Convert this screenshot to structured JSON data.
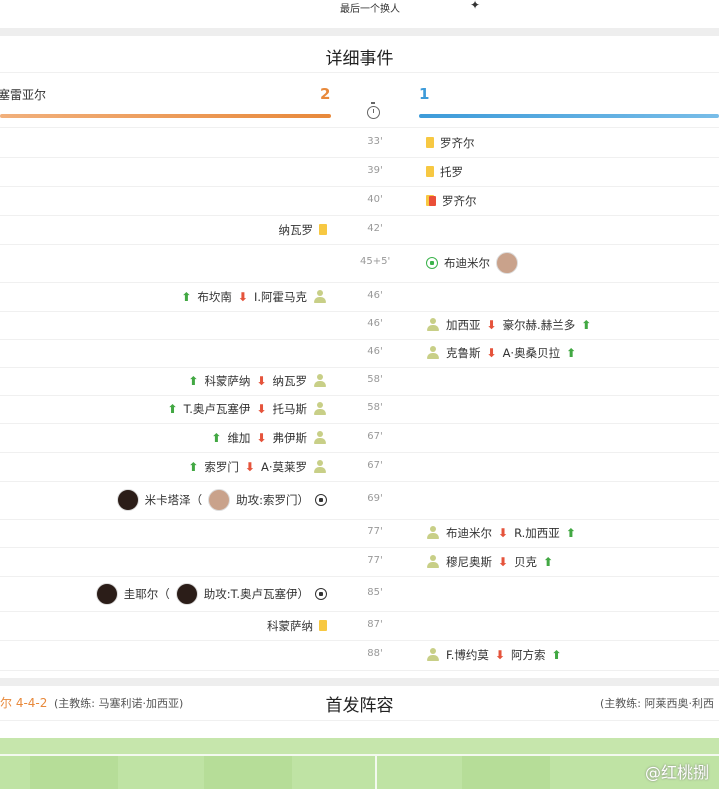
{
  "top": {
    "text": "最后一个换人",
    "icon": "star-icon"
  },
  "events": {
    "title": "详细事件",
    "home_name": "塞雷亚尔",
    "home_score": "2",
    "away_score": "1",
    "rows": [
      {
        "min": "33'",
        "left": [],
        "right": [
          {
            "t": "icon",
            "n": "yellow-card-icon"
          },
          {
            "t": "text",
            "v": "罗齐尔"
          }
        ]
      },
      {
        "min": "39'",
        "left": [],
        "right": [
          {
            "t": "icon",
            "n": "yellow-card-icon"
          },
          {
            "t": "text",
            "v": "托罗"
          }
        ]
      },
      {
        "min": "40'",
        "left": [],
        "right": [
          {
            "t": "icon",
            "n": "red-card-icon"
          },
          {
            "t": "text",
            "v": "罗齐尔"
          }
        ]
      },
      {
        "min": "42'",
        "left": [
          {
            "t": "text",
            "v": "纳瓦罗"
          },
          {
            "t": "icon",
            "n": "yellow-card-icon"
          }
        ],
        "right": []
      },
      {
        "min": "45+5'",
        "left": [],
        "right": [
          {
            "t": "icon",
            "n": "goal-ball-icon"
          },
          {
            "t": "text",
            "v": "布迪米尔"
          },
          {
            "t": "icon",
            "n": "player-avatar-light"
          }
        ]
      },
      {
        "min": "46'",
        "left": [
          {
            "t": "icon",
            "n": "sub-in-icon"
          },
          {
            "t": "text",
            "v": "布坎南"
          },
          {
            "t": "icon",
            "n": "sub-out-icon"
          },
          {
            "t": "text",
            "v": "I.阿霍马克"
          },
          {
            "t": "icon",
            "n": "substitution-person-icon"
          }
        ],
        "right": []
      },
      {
        "min": "46'",
        "left": [],
        "right": [
          {
            "t": "icon",
            "n": "substitution-person-icon"
          },
          {
            "t": "text",
            "v": "加西亚"
          },
          {
            "t": "icon",
            "n": "sub-out-icon"
          },
          {
            "t": "text",
            "v": "豪尔赫.赫兰多"
          },
          {
            "t": "icon",
            "n": "sub-in-icon"
          }
        ]
      },
      {
        "min": "46'",
        "left": [],
        "right": [
          {
            "t": "icon",
            "n": "substitution-person-icon"
          },
          {
            "t": "text",
            "v": "克鲁斯"
          },
          {
            "t": "icon",
            "n": "sub-out-icon"
          },
          {
            "t": "text",
            "v": "A·奥桑贝拉"
          },
          {
            "t": "icon",
            "n": "sub-in-icon"
          }
        ]
      },
      {
        "min": "58'",
        "left": [
          {
            "t": "icon",
            "n": "sub-in-icon"
          },
          {
            "t": "text",
            "v": "科蒙萨纳"
          },
          {
            "t": "icon",
            "n": "sub-out-icon"
          },
          {
            "t": "text",
            "v": "纳瓦罗"
          },
          {
            "t": "icon",
            "n": "substitution-person-icon"
          }
        ],
        "right": []
      },
      {
        "min": "58'",
        "left": [
          {
            "t": "icon",
            "n": "sub-in-icon"
          },
          {
            "t": "text",
            "v": "T.奥卢瓦塞伊"
          },
          {
            "t": "icon",
            "n": "sub-out-icon"
          },
          {
            "t": "text",
            "v": "托马斯"
          },
          {
            "t": "icon",
            "n": "substitution-person-icon"
          }
        ],
        "right": []
      },
      {
        "min": "67'",
        "left": [
          {
            "t": "icon",
            "n": "sub-in-icon"
          },
          {
            "t": "text",
            "v": "维加"
          },
          {
            "t": "icon",
            "n": "sub-out-icon"
          },
          {
            "t": "text",
            "v": "弗伊斯"
          },
          {
            "t": "icon",
            "n": "substitution-person-icon"
          }
        ],
        "right": []
      },
      {
        "min": "67'",
        "left": [
          {
            "t": "icon",
            "n": "sub-in-icon"
          },
          {
            "t": "text",
            "v": "索罗门"
          },
          {
            "t": "icon",
            "n": "sub-out-icon"
          },
          {
            "t": "text",
            "v": "A·莫莱罗"
          },
          {
            "t": "icon",
            "n": "substitution-person-icon"
          }
        ],
        "right": []
      },
      {
        "min": "69'",
        "left": [
          {
            "t": "icon",
            "n": "player-avatar-dark"
          },
          {
            "t": "text",
            "v": "米卡塔泽（"
          },
          {
            "t": "icon",
            "n": "player-avatar-light"
          },
          {
            "t": "text",
            "v": "助攻:索罗门）"
          },
          {
            "t": "icon",
            "n": "goal-ball-icon-dark"
          }
        ],
        "right": []
      },
      {
        "min": "77'",
        "left": [],
        "right": [
          {
            "t": "icon",
            "n": "substitution-person-icon"
          },
          {
            "t": "text",
            "v": "布迪米尔"
          },
          {
            "t": "icon",
            "n": "sub-out-icon"
          },
          {
            "t": "text",
            "v": "R.加西亚"
          },
          {
            "t": "icon",
            "n": "sub-in-icon"
          }
        ]
      },
      {
        "min": "77'",
        "left": [],
        "right": [
          {
            "t": "icon",
            "n": "substitution-person-icon"
          },
          {
            "t": "text",
            "v": "穆尼奥斯"
          },
          {
            "t": "icon",
            "n": "sub-out-icon"
          },
          {
            "t": "text",
            "v": "贝克"
          },
          {
            "t": "icon",
            "n": "sub-in-icon"
          }
        ]
      },
      {
        "min": "85'",
        "left": [
          {
            "t": "icon",
            "n": "player-avatar-dark"
          },
          {
            "t": "text",
            "v": "圭耶尔（"
          },
          {
            "t": "icon",
            "n": "player-avatar-dark"
          },
          {
            "t": "text",
            "v": "助攻:T.奥卢瓦塞伊）"
          },
          {
            "t": "icon",
            "n": "goal-ball-icon-dark"
          }
        ],
        "right": []
      },
      {
        "min": "87'",
        "left": [
          {
            "t": "text",
            "v": "科蒙萨纳"
          },
          {
            "t": "icon",
            "n": "yellow-card-icon"
          }
        ],
        "right": []
      },
      {
        "min": "88'",
        "left": [],
        "right": [
          {
            "t": "icon",
            "n": "substitution-person-icon"
          },
          {
            "t": "text",
            "v": "F.博约莫"
          },
          {
            "t": "icon",
            "n": "sub-out-icon"
          },
          {
            "t": "text",
            "v": "阿方索"
          },
          {
            "t": "icon",
            "n": "sub-in-icon"
          }
        ]
      }
    ]
  },
  "lineup": {
    "title": "首发阵容",
    "home_formation": "尔 4-4-2",
    "home_coach": "(主教练: 马塞利诺·加西亚)",
    "away_coach": "(主教练: 阿莱西奥·利西"
  },
  "watermark": "@红桃捌",
  "colors": {
    "home": "#e8893b",
    "away": "#3d9bd9",
    "sub_in": "#42a843",
    "sub_out": "#e5533b",
    "yellow": "#f7c842",
    "red": "#ea4f38"
  }
}
